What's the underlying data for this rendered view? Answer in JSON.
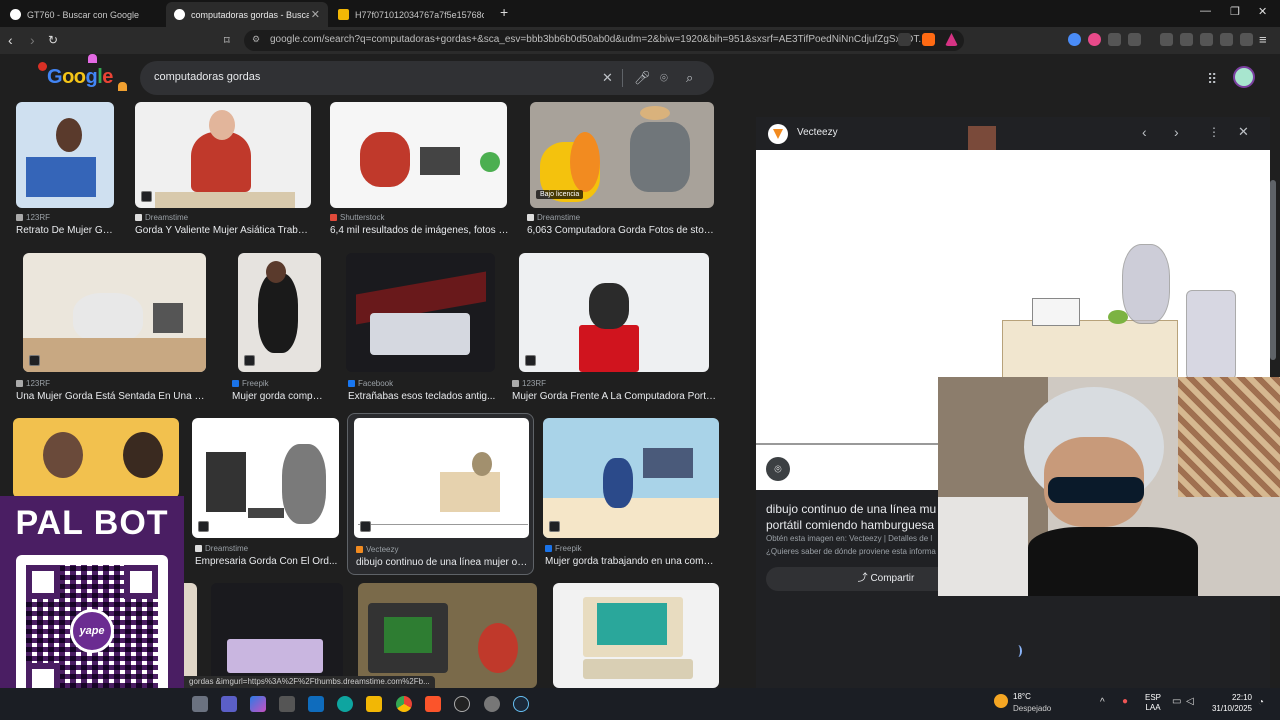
{
  "browser": {
    "tabs": [
      {
        "title": "GT760 - Buscar con Google"
      },
      {
        "title": "computadoras gordas - Buscar c"
      },
      {
        "title": "H77f071012034767a7f5e15768cd5"
      }
    ],
    "new_tab": "+",
    "url": "google.com/search?q=computadoras+gordas+&sca_esv=bbb3bb6b0d50ab0d&udm=2&biw=1920&bih=951&sxsrf=AE3TifPoedNiNnCdjufZgSxaDT...",
    "status_url": "gordas &imgurl=https%3A%2F%2Fthumbs.dreamstime.com%2Fb..."
  },
  "search": {
    "query": "computadoras gordas",
    "logo": "Google"
  },
  "results": [
    {
      "source": "123RF",
      "caption": "Retrato De Mujer Go..."
    },
    {
      "source": "Dreamstime",
      "caption": "Gorda Y Valiente Mujer Asiática Trabaj..."
    },
    {
      "source": "Shutterstock",
      "caption": "6,4 mil resultados de imágenes, fotos d..."
    },
    {
      "source": "Dreamstime",
      "caption": "6,063 Computadora Gorda Fotos de stock...",
      "label": "Bajo licencia"
    },
    {
      "source": "123RF",
      "caption": "Una Mujer Gorda Está Sentada En Una Ha..."
    },
    {
      "source": "Freepik",
      "caption": "Mujer gorda comput..."
    },
    {
      "source": "Facebook",
      "caption": "Extrañabas esos teclados antig..."
    },
    {
      "source": "123RF",
      "caption": "Mujer Gorda Frente A La Computadora Portát..."
    },
    {
      "source": "Dreamstime",
      "caption": "Empresaria Gorda Con El Ord..."
    },
    {
      "source": "Vecteezy",
      "caption": "dibujo continuo de una línea mujer ob..."
    },
    {
      "source": "Freepik",
      "caption": "Mujer gorda trabajando en una comp..."
    }
  ],
  "panel": {
    "site": "Vecteezy",
    "title": "dibujo continuo de una línea mu portátil comiendo hamburguesa",
    "title_line1": "dibujo continuo de una línea mu",
    "title_line2": "portátil comiendo hamburguesa",
    "meta": "Obtén esta imagen en: Vecteezy | Detalles de l",
    "question": "¿Quieres saber de dónde proviene esta informa",
    "share": "Compartir"
  },
  "overlay": {
    "palbot": "PAL BOT",
    "yape": "yape"
  },
  "taskbar": {
    "temp": "18°C",
    "weather": "Despejado",
    "lang1": "ESP",
    "lang2": "LAA",
    "time": "22:10",
    "date": "31/10/2025"
  },
  "colors": {
    "accent": "#8ab4f8",
    "panel_bg": "#202124",
    "palbot_bg": "#4a1e63"
  }
}
